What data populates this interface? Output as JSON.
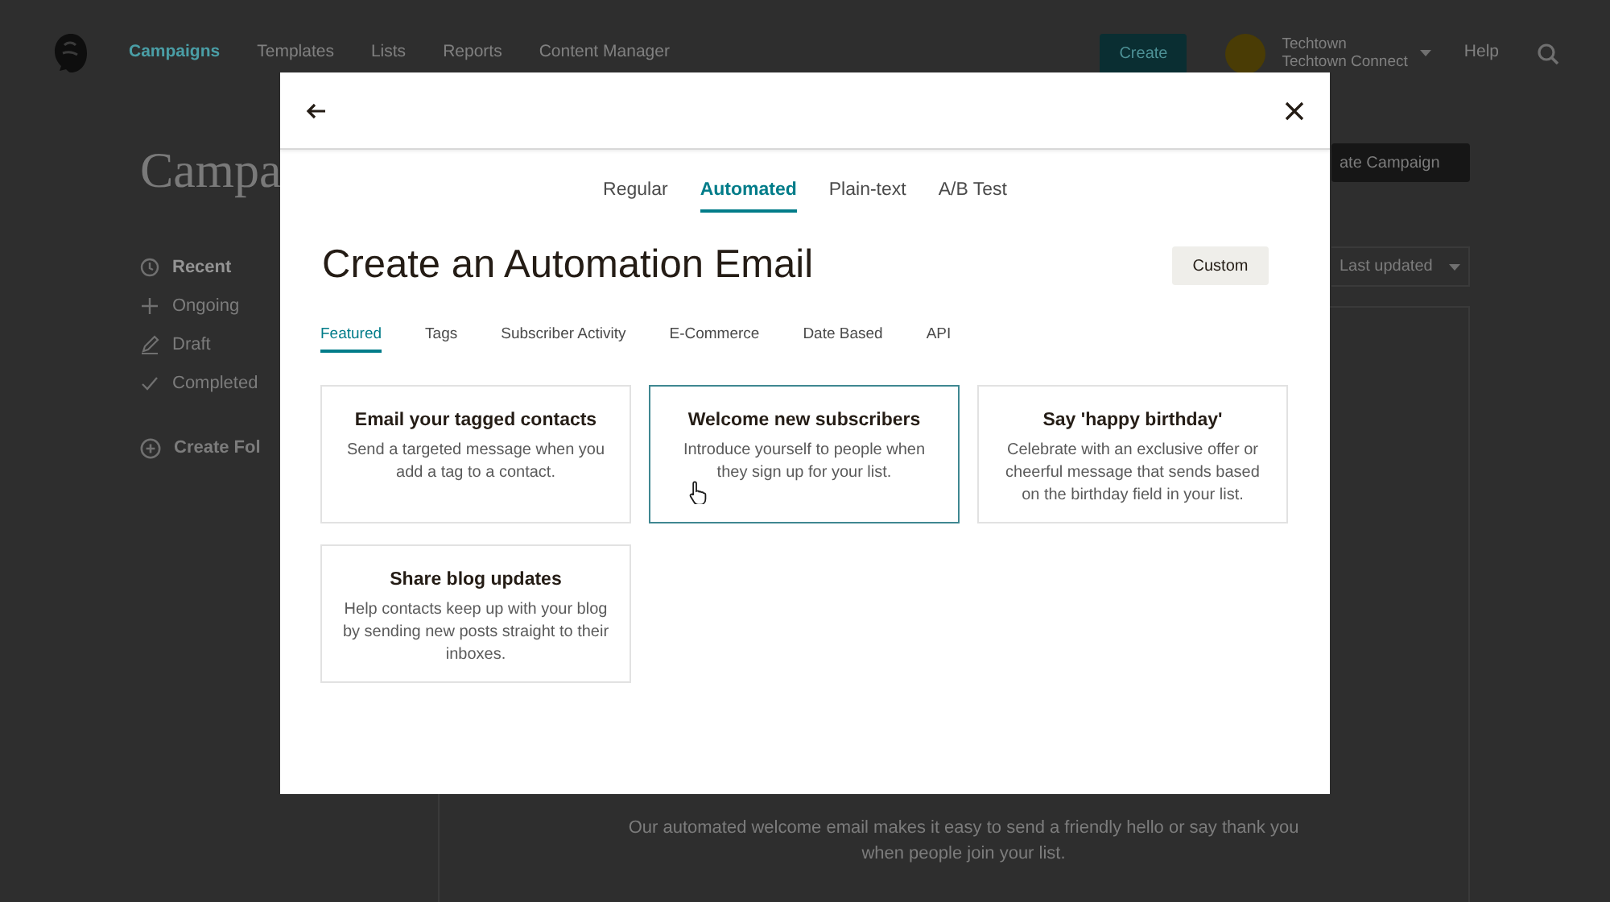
{
  "background": {
    "nav": {
      "items": [
        {
          "label": "Campaigns",
          "selected": true
        },
        {
          "label": "Templates",
          "selected": false
        },
        {
          "label": "Lists",
          "selected": false
        },
        {
          "label": "Reports",
          "selected": false
        },
        {
          "label": "Content Manager",
          "selected": false
        }
      ],
      "create_button": "Create",
      "account": {
        "name": "Techtown",
        "organization": "Techtown Connect"
      },
      "help": "Help"
    },
    "page_title": "Campa",
    "sidebar": {
      "items": [
        {
          "label": "Recent",
          "selected": true
        },
        {
          "label": "Ongoing",
          "selected": false
        },
        {
          "label": "Draft",
          "selected": false
        },
        {
          "label": "Completed",
          "selected": false
        }
      ],
      "create_folder": "Create Fol"
    },
    "create_campaign_button": "ate Campaign",
    "sort_dropdown": "Last updated",
    "empty_state_text": "Our automated welcome email makes it easy to send a friendly hello or say thank you when people join your list."
  },
  "modal": {
    "tabs": [
      {
        "label": "Regular",
        "selected": false
      },
      {
        "label": "Automated",
        "selected": true
      },
      {
        "label": "Plain-text",
        "selected": false
      },
      {
        "label": "A/B Test",
        "selected": false
      }
    ],
    "title": "Create an Automation Email",
    "custom_button": "Custom",
    "categories": [
      {
        "label": "Featured",
        "selected": true
      },
      {
        "label": "Tags",
        "selected": false
      },
      {
        "label": "Subscriber Activity",
        "selected": false
      },
      {
        "label": "E-Commerce",
        "selected": false
      },
      {
        "label": "Date Based",
        "selected": false
      },
      {
        "label": "API",
        "selected": false
      }
    ],
    "cards": [
      {
        "title": "Email your tagged contacts",
        "description": "Send a targeted message when you add a tag to a contact.",
        "selected": false
      },
      {
        "title": "Welcome new subscribers",
        "description": "Introduce yourself to people when they sign up for your list.",
        "selected": true
      },
      {
        "title": "Say 'happy birthday'",
        "description": "Celebrate with an exclusive offer or cheerful message that sends based on the birthday field in your list.",
        "selected": false
      },
      {
        "title": "Share blog updates",
        "description": "Help contacts keep up with your blog by sending new posts straight to their inboxes.",
        "selected": false
      }
    ]
  }
}
